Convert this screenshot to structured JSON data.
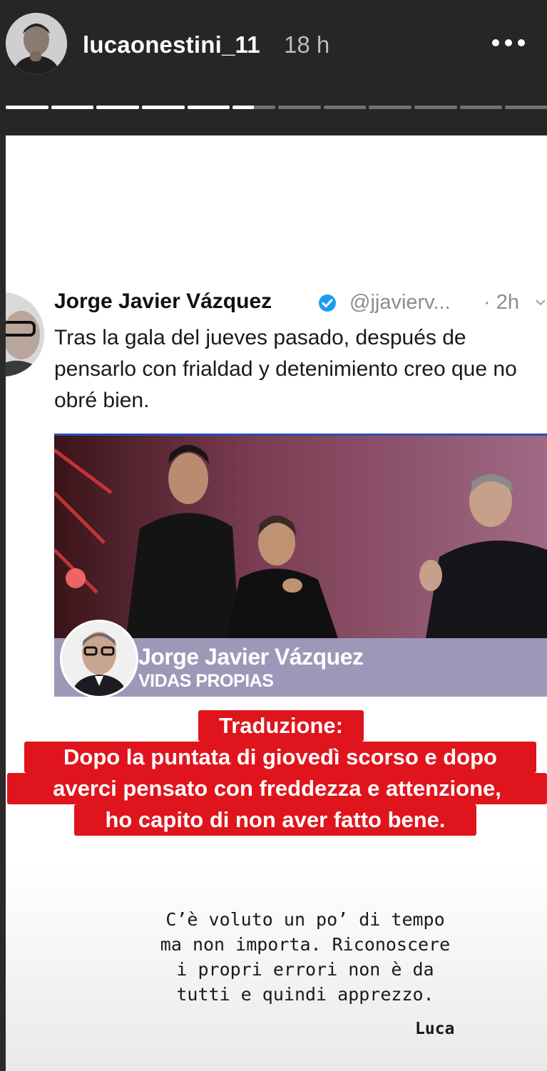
{
  "story": {
    "username": "lucaonestini_11",
    "time_ago": "18 h",
    "more_icon": "more-horizontal-icon",
    "progress": {
      "segments": 12,
      "completed": 5,
      "current_fraction": 0.5
    }
  },
  "tweet": {
    "author": "Jorge Javier Vázquez",
    "verified": true,
    "handle": "@jjavierv...",
    "time": "· 2h",
    "text": "Tras la gala del jueves pasado, después de pensarlo con frialdad y detenimiento creo que no obré bien.",
    "media": {
      "band_name": "Jorge Javier Vázquez",
      "band_subtitle": "VIDAS PROPIAS"
    }
  },
  "translation": {
    "title": "Traduzione:",
    "line1": "Dopo la puntata di giovedì scorso e dopo",
    "line2": "averci pensato con freddezza e attenzione,",
    "line3": "ho capito di non aver fatto bene."
  },
  "message": {
    "text": "C’è voluto un po’ di tempo\nma non importa. Riconoscere\ni propri errori non è da\ntutti e quindi apprezzo.",
    "signature": "Luca"
  },
  "colors": {
    "header_bg": "#262626",
    "translation_bg": "#e0141c",
    "verified_blue": "#1d9bf0",
    "band_purple": "#9e98b8"
  }
}
